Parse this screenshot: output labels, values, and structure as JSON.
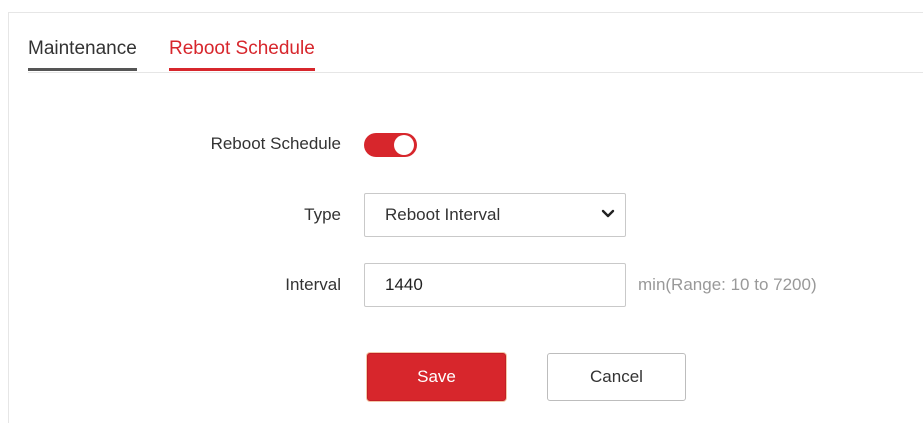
{
  "tabs": {
    "maintenance": "Maintenance",
    "reboot_schedule": "Reboot Schedule"
  },
  "form": {
    "reboot_schedule_label": "Reboot Schedule",
    "reboot_schedule_enabled": true,
    "type_label": "Type",
    "type_value": "Reboot Interval",
    "interval_label": "Interval",
    "interval_value": "1440",
    "interval_hint": "min(Range: 10 to 7200)"
  },
  "buttons": {
    "save": "Save",
    "cancel": "Cancel"
  },
  "colors": {
    "accent": "#d7262c",
    "text": "#333333",
    "hint": "#999999"
  },
  "icons": {
    "select_arrow": "chevron-down-icon"
  }
}
